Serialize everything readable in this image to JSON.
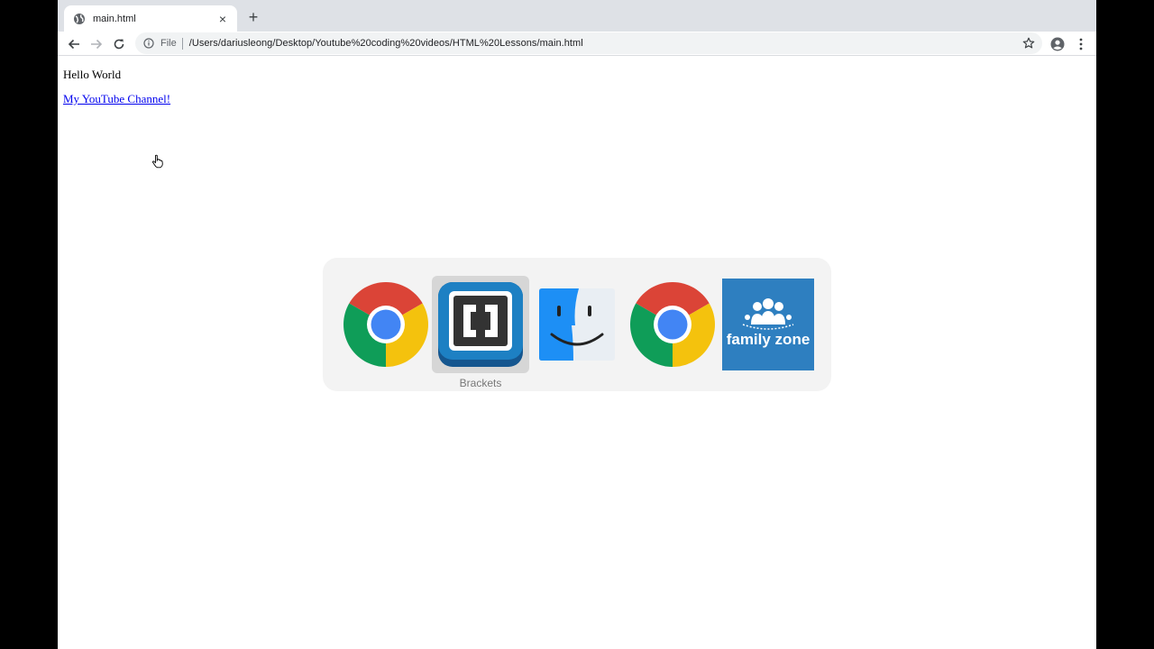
{
  "browser": {
    "tab": {
      "title": "main.html",
      "favicon": "globe-icon",
      "close": "×"
    },
    "new_tab": "+",
    "omnibox": {
      "scheme": "File",
      "url": "/Users/dariusleong/Desktop/Youtube%20coding%20videos/HTML%20Lessons/main.html"
    }
  },
  "page": {
    "heading": "Hello World",
    "link": "My YouTube Channel!"
  },
  "app_switcher": {
    "apps": [
      {
        "icon": "chrome-icon"
      },
      {
        "icon": "brackets-icon",
        "label": "Brackets",
        "selected": true
      },
      {
        "icon": "finder-icon"
      },
      {
        "icon": "chrome-icon"
      },
      {
        "icon": "family-zone-icon",
        "text": "family zone"
      }
    ]
  },
  "colors": {
    "tabstrip": "#dee1e6",
    "link": "#0000ee",
    "brackets_blue": "#1d80c3",
    "family_zone_blue": "#2e7fc0"
  }
}
